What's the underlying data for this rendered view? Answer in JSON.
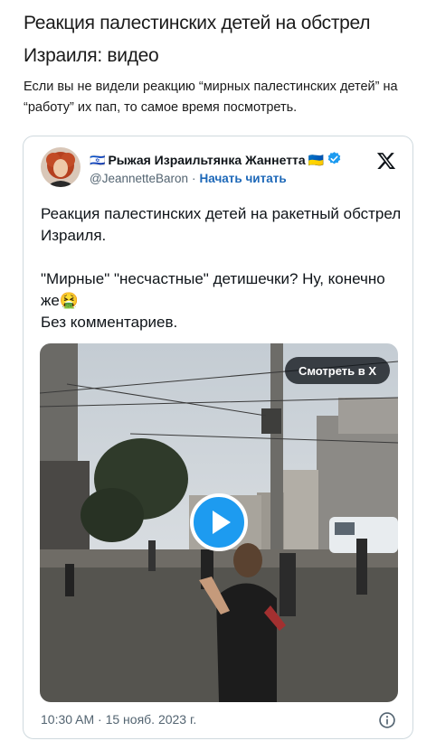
{
  "article": {
    "headline": "Реакция палестинских детей на обстрел Израиля: видео",
    "lead": "Если вы не видели реакцию “мирных палестинских детей” на “работу” их пап, то самое время посмотреть."
  },
  "tweet": {
    "author": {
      "flag_prefix": "🇮🇱",
      "name": "Рыжая Израильтянка Жаннетта",
      "flag_suffix": "🇺🇦",
      "verified": true,
      "handle": "@JeannetteBaron",
      "separator": "·",
      "follow_label": "Начать читать"
    },
    "platform_icon": "x-logo-icon",
    "text": {
      "line1": "Реакция палестинских детей на ракетный обстрел Израиля.",
      "line2": "\"Мирные\" \"несчастные\" детишечки? Ну, конечно же🤮",
      "line3": "Без комментариев."
    },
    "media": {
      "watch_label": "Смотреть в X",
      "play_icon": "play-icon"
    },
    "timestamp": "10:30 AM · 15 нояб. 2023 г.",
    "info_icon": "info-icon"
  },
  "colors": {
    "accent": "#1d9bf0",
    "link": "#1d68b8",
    "muted": "#536471",
    "border": "#cfd9de"
  }
}
